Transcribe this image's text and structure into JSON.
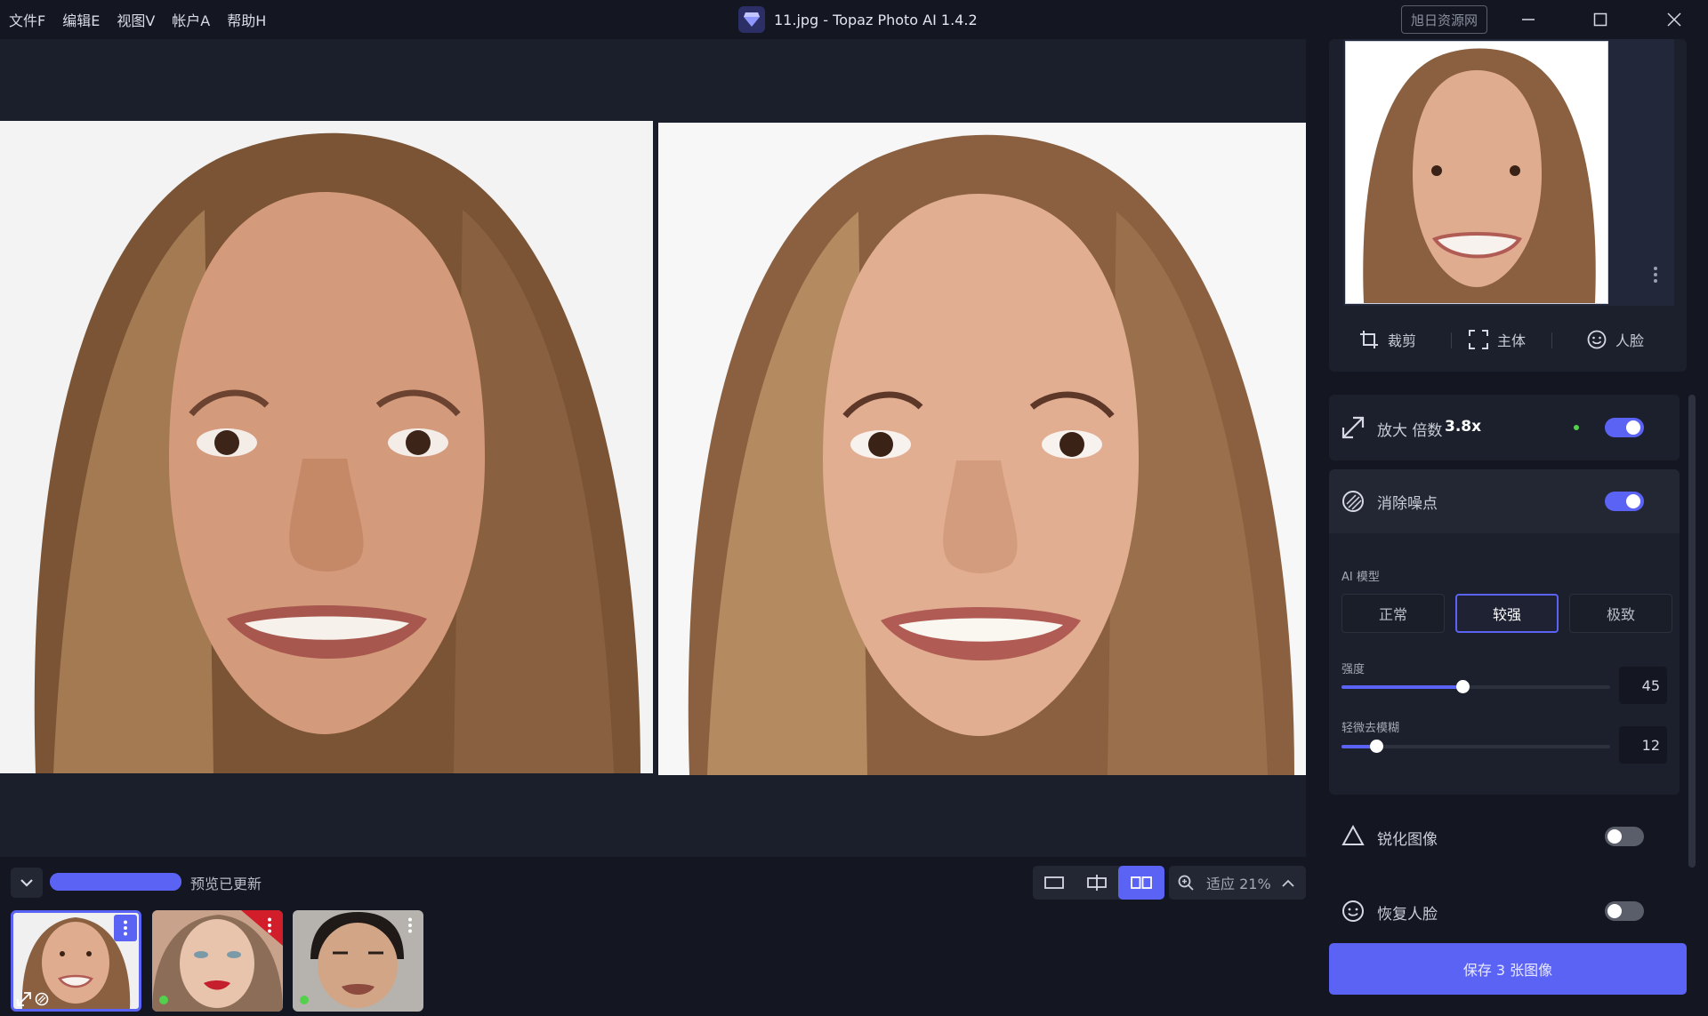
{
  "menu": [
    "文件F",
    "编辑E",
    "视图V",
    "帐户A",
    "帮助H"
  ],
  "app": {
    "title": "11.jpg - Topaz Photo AI 1.4.2",
    "watermark": "旭日资源网"
  },
  "colors": {
    "accent": "#5b63f5",
    "bg": "#141722",
    "canvas": "#1b1f2c",
    "card": "#1c202c",
    "green": "#53d14d"
  },
  "nav_tools": {
    "crop": "裁剪",
    "subject": "主体",
    "face": "人脸"
  },
  "upscale": {
    "label": "放大 倍数",
    "value": "3.8x",
    "enabled": true
  },
  "denoise": {
    "label": "消除噪点",
    "enabled": true,
    "ai_model_label": "AI 模型",
    "models": [
      "正常",
      "较强",
      "极致"
    ],
    "selected_model": "较强",
    "strength_label": "强度",
    "strength_value": "45",
    "strength_fraction": 0.45,
    "deblur_label": "轻微去模糊",
    "deblur_value": "12",
    "deblur_fraction": 0.12
  },
  "sharpen": {
    "label": "锐化图像",
    "enabled": false
  },
  "face_recovery": {
    "label": "恢复人脸",
    "enabled": false
  },
  "save_button": "保存 3 张图像",
  "status": {
    "preview": "预览已更新",
    "zoom": "适应 21%"
  },
  "icons": {
    "logo": "topaz-gem-icon",
    "crop": "crop-icon",
    "subject": "focus-frame-icon",
    "face": "smile-icon",
    "upscale": "expand-arrow-icon",
    "denoise": "noise-circle-icon",
    "sharpen": "triangle-icon",
    "recover": "smile-icon"
  }
}
